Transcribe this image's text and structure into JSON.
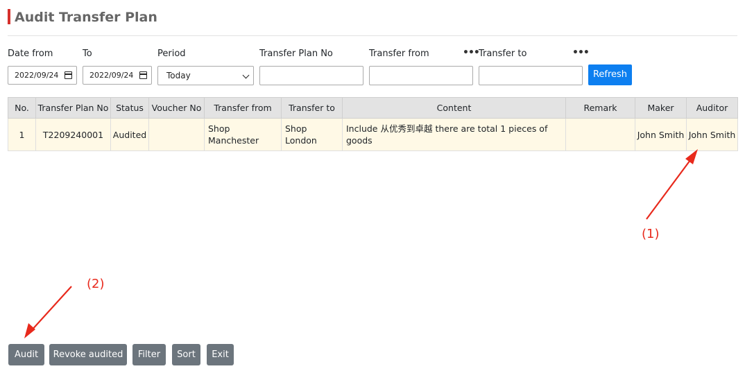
{
  "page": {
    "title": "Audit Transfer Plan"
  },
  "filters": {
    "date_from_label": "Date from",
    "to_label": "To",
    "period_label": "Period",
    "plan_no_label": "Transfer Plan No",
    "transfer_from_label": "Transfer from",
    "transfer_to_label": "Transfer to",
    "more_glyph": "•••",
    "date_from_value": "2022/09/24",
    "to_value": "2022/09/24",
    "period_value": "Today",
    "refresh_label": "Refresh"
  },
  "table": {
    "headers": [
      "No.",
      "Transfer Plan No",
      "Status",
      "Voucher No",
      "Transfer from",
      "Transfer to",
      "Content",
      "Remark",
      "Maker",
      "Auditor"
    ],
    "rows": [
      {
        "no": "1",
        "plan_no": "T2209240001",
        "status": "Audited",
        "voucher_no": "",
        "transfer_from": "Shop Manchester",
        "transfer_to": "Shop London",
        "content": "Include 从优秀到卓越 there are total 1 pieces of goods",
        "remark": "",
        "maker": "John Smith",
        "auditor": "John Smith"
      }
    ]
  },
  "annotations": {
    "label_1": "(1)",
    "label_2": "(2)",
    "arrow_color": "#e8291c"
  },
  "actions": {
    "audit": "Audit",
    "revoke": "Revoke audited",
    "filter": "Filter",
    "sort": "Sort",
    "exit": "Exit"
  },
  "colors": {
    "accent": "#d6302c",
    "primary_button": "#0d7ff0",
    "secondary_button": "#6c757d",
    "row_highlight": "#fff9e6",
    "header_bg": "#e3e3e3"
  }
}
